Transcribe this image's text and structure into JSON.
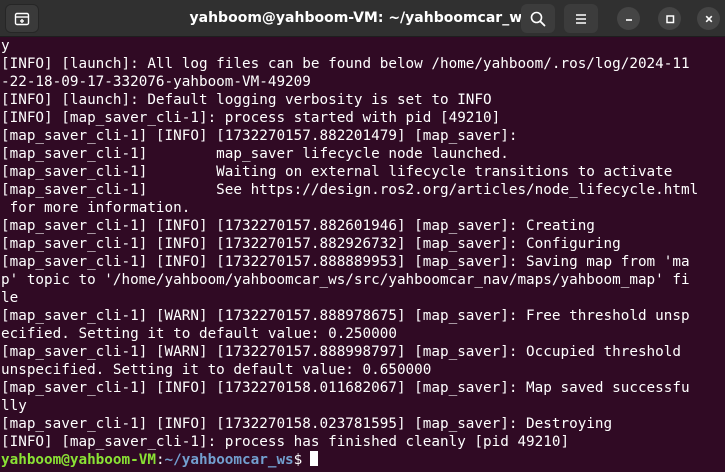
{
  "window": {
    "title": "yahboom@yahboom-VM: ~/yahboomcar_ws",
    "icons": {
      "new_tab": "new-tab-icon",
      "search": "search-icon",
      "menu": "hamburger-menu-icon",
      "minimize": "minimize-icon",
      "maximize": "maximize-icon",
      "close": "close-icon"
    }
  },
  "colors": {
    "background": "#300a24",
    "text": "#ffffff",
    "prompt_user": "#8ae234",
    "prompt_path": "#729fcf",
    "titlebar": "#303030"
  },
  "terminal": {
    "lines": [
      "y",
      "[INFO] [launch]: All log files can be found below /home/yahboom/.ros/log/2024-11",
      "-22-18-09-17-332076-yahboom-VM-49209",
      "[INFO] [launch]: Default logging verbosity is set to INFO",
      "[INFO] [map_saver_cli-1]: process started with pid [49210]",
      "[map_saver_cli-1] [INFO] [1732270157.882201479] [map_saver]:",
      "[map_saver_cli-1]        map_saver lifecycle node launched.",
      "[map_saver_cli-1]        Waiting on external lifecycle transitions to activate",
      "[map_saver_cli-1]        See https://design.ros2.org/articles/node_lifecycle.html",
      " for more information.",
      "[map_saver_cli-1] [INFO] [1732270157.882601946] [map_saver]: Creating",
      "[map_saver_cli-1] [INFO] [1732270157.882926732] [map_saver]: Configuring",
      "[map_saver_cli-1] [INFO] [1732270157.888889953] [map_saver]: Saving map from 'ma",
      "p' topic to '/home/yahboom/yahboomcar_ws/src/yahboomcar_nav/maps/yahboom_map' fi",
      "le",
      "[map_saver_cli-1] [WARN] [1732270157.888978675] [map_saver]: Free threshold unsp",
      "ecified. Setting it to default value: 0.250000",
      "[map_saver_cli-1] [WARN] [1732270157.888998797] [map_saver]: Occupied threshold",
      "unspecified. Setting it to default value: 0.650000",
      "[map_saver_cli-1] [INFO] [1732270158.011682067] [map_saver]: Map saved successfu",
      "lly",
      "[map_saver_cli-1] [INFO] [1732270158.023781595] [map_saver]: Destroying",
      "[INFO] [map_saver_cli-1]: process has finished cleanly [pid 49210]"
    ],
    "prompt": {
      "user_host": "yahboom@yahboom-VM",
      "colon": ":",
      "path": "~/yahboomcar_ws",
      "symbol": "$"
    }
  }
}
